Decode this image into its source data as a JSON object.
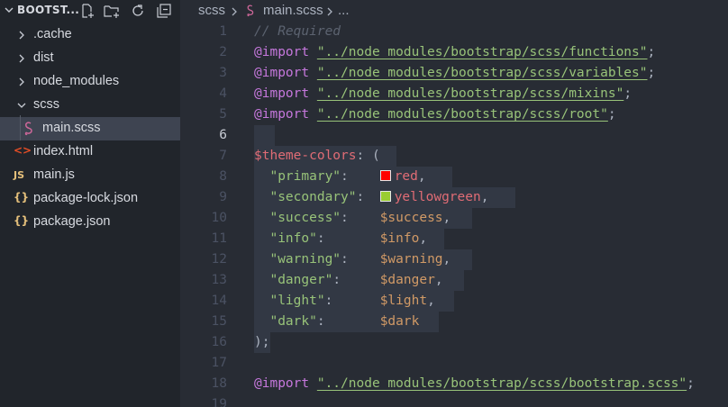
{
  "explorer": {
    "title": "BOOTST...",
    "items": [
      {
        "label": ".cache",
        "kind": "folder",
        "expanded": false
      },
      {
        "label": "dist",
        "kind": "folder",
        "expanded": false
      },
      {
        "label": "node_modules",
        "kind": "folder",
        "expanded": false
      },
      {
        "label": "scss",
        "kind": "folder",
        "expanded": true
      },
      {
        "label": "main.scss",
        "kind": "sass-file",
        "selected": true
      },
      {
        "label": "index.html",
        "kind": "html-file",
        "icon_text": "<>"
      },
      {
        "label": "main.js",
        "kind": "js-file",
        "icon_text": "JS"
      },
      {
        "label": "package-lock.json",
        "kind": "json-file",
        "icon_text": "{}"
      },
      {
        "label": "package.json",
        "kind": "json-file",
        "icon_text": "{}"
      }
    ]
  },
  "breadcrumb": {
    "folder": "scss",
    "file": "main.scss",
    "more": "..."
  },
  "editor": {
    "current_line": 6,
    "line_numbers": [
      "1",
      "2",
      "3",
      "4",
      "5",
      "6",
      "7",
      "8",
      "9",
      "10",
      "11",
      "12",
      "13",
      "14",
      "15",
      "16",
      "17",
      "18",
      "19"
    ],
    "comment": "// Required",
    "import_kw": "@import",
    "imports": [
      "\"../node_modules/bootstrap/scss/functions\"",
      "\"../node_modules/bootstrap/scss/variables\"",
      "\"../node_modules/bootstrap/scss/mixins\"",
      "\"../node_modules/bootstrap/scss/root\""
    ],
    "map_var": "$theme-colors",
    "map_open": ": (",
    "map_close": ");",
    "entries": [
      {
        "key": "\"primary\"",
        "value": "red",
        "swatch": "#ff0000",
        "sep": ","
      },
      {
        "key": "\"secondary\"",
        "value": "yellowgreen",
        "swatch": "#9acd32",
        "sep": ","
      },
      {
        "key": "\"success\"",
        "value": "$success",
        "sep": ","
      },
      {
        "key": "\"info\"",
        "value": "$info",
        "sep": ","
      },
      {
        "key": "\"warning\"",
        "value": "$warning",
        "sep": ","
      },
      {
        "key": "\"danger\"",
        "value": "$danger",
        "sep": ","
      },
      {
        "key": "\"light\"",
        "value": "$light",
        "sep": ","
      },
      {
        "key": "\"dark\"",
        "value": "$dark",
        "sep": ""
      }
    ],
    "final_import": "\"../node_modules/bootstrap/scss/bootstrap.scss\"",
    "semicolon": ";",
    "colon": ":"
  },
  "colors": {
    "sidebar_bg": "#21252b",
    "editor_bg": "#282c34",
    "keyword": "#c678dd",
    "string": "#98c379",
    "variable": "#e06c75",
    "value": "#d19a66",
    "comment": "#5c6370"
  }
}
